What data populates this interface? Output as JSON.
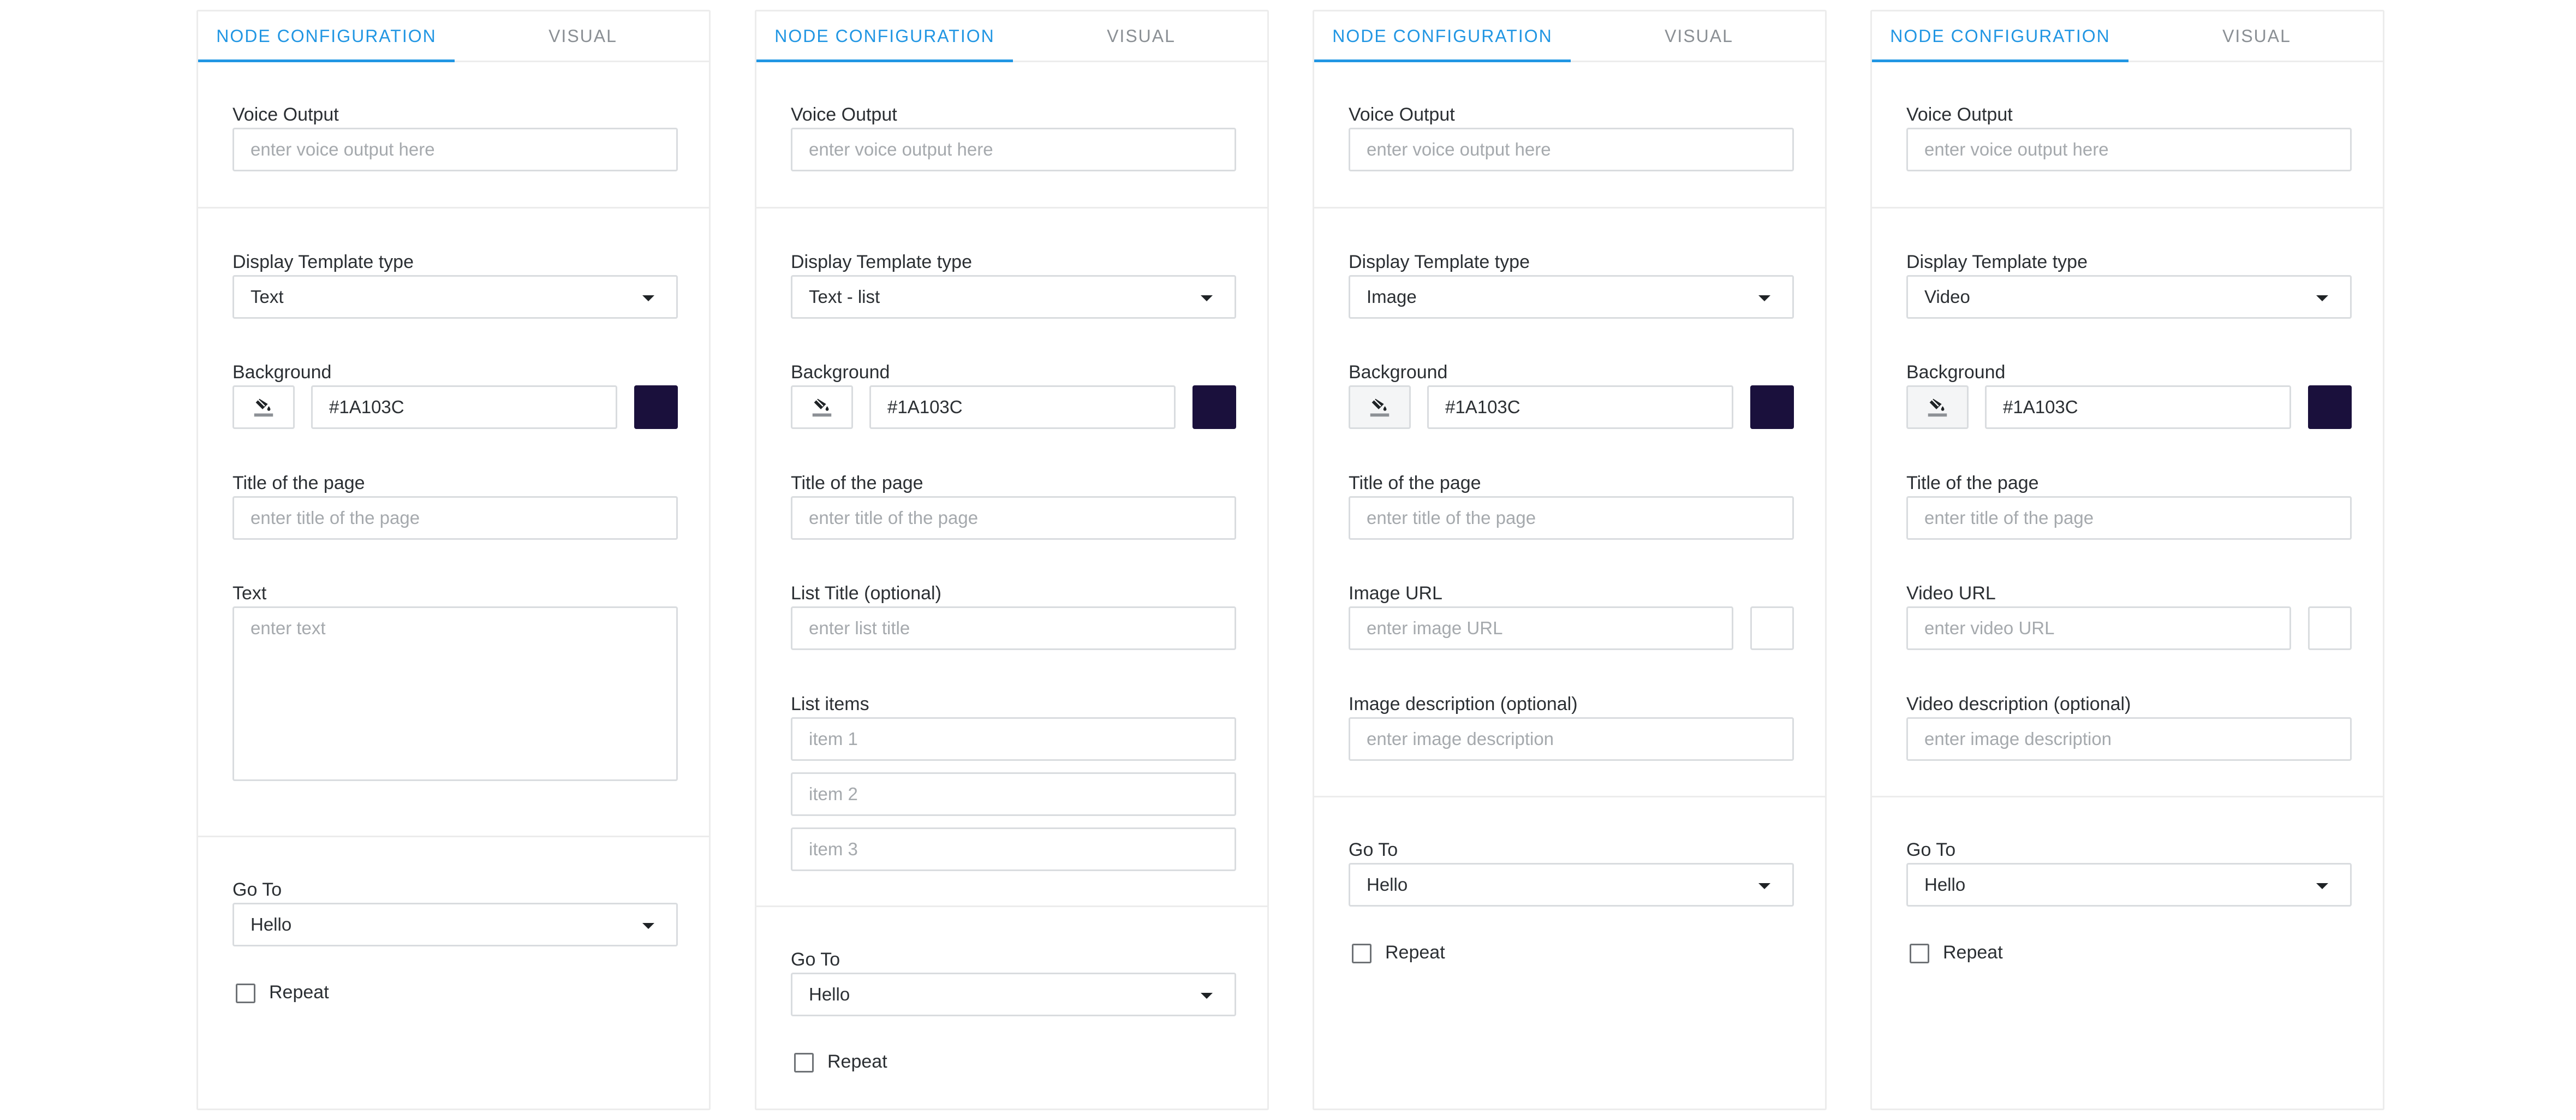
{
  "colors": {
    "accent": "#2196e3",
    "background_swatch": "#1A103C"
  },
  "tabs": {
    "config": "NODE CONFIGURATION",
    "visual": "VISUAL"
  },
  "common": {
    "voice_output_label": "Voice Output",
    "voice_output_placeholder": "enter voice output here",
    "template_type_label": "Display Template type",
    "background_label": "Background",
    "background_value": "#1A103C",
    "page_title_label": "Title of the page",
    "page_title_placeholder": "enter title of the page",
    "goto_label": "Go To",
    "goto_value": "Hello",
    "repeat_label": "Repeat"
  },
  "panels": [
    {
      "template_type": "Text",
      "text_label": "Text",
      "text_placeholder": "enter text"
    },
    {
      "template_type": "Text - list",
      "list_title_label": "List Title (optional)",
      "list_title_placeholder": "enter list title",
      "list_items_label": "List items",
      "list_items": [
        "item 1",
        "item 2",
        "item 3"
      ]
    },
    {
      "template_type": "Image",
      "url_label": "Image URL",
      "url_placeholder": "enter image URL",
      "desc_label": "Image description (optional)",
      "desc_placeholder": "enter image description"
    },
    {
      "template_type": "Video",
      "url_label": "Video URL",
      "url_placeholder": "enter video URL",
      "desc_label": "Video description (optional)",
      "desc_placeholder": "enter image description"
    }
  ]
}
